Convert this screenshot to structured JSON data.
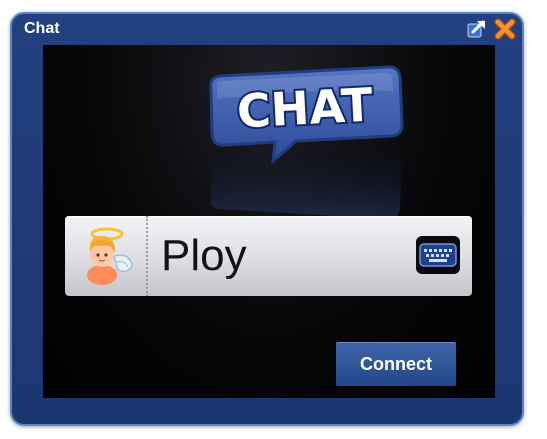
{
  "window": {
    "title": "Chat",
    "popout_icon": "popout-arrow-icon",
    "close_icon": "close-x-icon"
  },
  "logo": {
    "text": "CHAT"
  },
  "profile": {
    "avatar_icon": "angel-avatar-icon",
    "username": "Ploy",
    "keyboard_icon": "keyboard-icon"
  },
  "actions": {
    "connect_label": "Connect"
  },
  "colors": {
    "frame": "#1f3b78",
    "frame_border": "#5c86c6",
    "content_bg": "#000000",
    "accent_orange": "#ee7d1e",
    "button": "#2f549a"
  }
}
